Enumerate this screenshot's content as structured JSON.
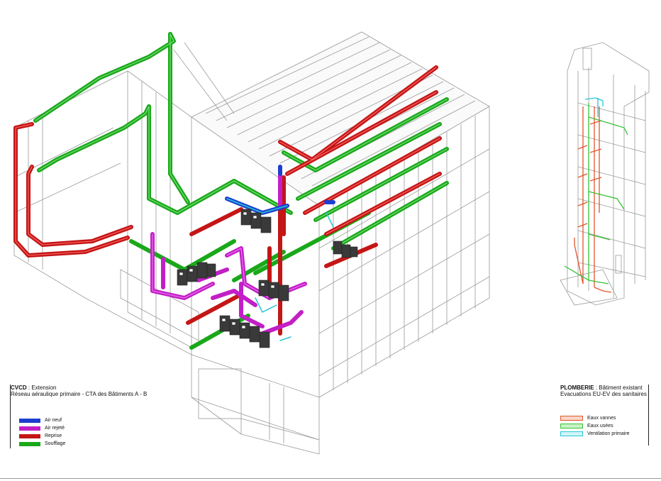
{
  "left_legend": {
    "title_bold": "CVCD",
    "title_rest": " : Extension",
    "subtitle": "Réseau aéraulique primaire - CTA des Bâtiments A - B",
    "items": [
      {
        "label": "Air neuf",
        "color": "#1d3fcf"
      },
      {
        "label": "Air rejeté",
        "color": "#c21fc7"
      },
      {
        "label": "Reprise",
        "color": "#c41616"
      },
      {
        "label": "Soufflage",
        "color": "#1aa81a"
      }
    ]
  },
  "right_legend": {
    "title_bold": "PLOMBERIE",
    "title_rest": " : Bâtiment existant",
    "subtitle": "Evacuations EU-EV des sanitaires",
    "items": [
      {
        "label": "Eaux vannes",
        "color": "#e0562e"
      },
      {
        "label": "Eaux usées",
        "color": "#36c236"
      },
      {
        "label": "Ventilation primaire",
        "color": "#27c6d4"
      }
    ]
  },
  "colors": {
    "air_neuf": "#1d3fcf",
    "air_rejete": "#c21fc7",
    "reprise": "#c41616",
    "soufflage": "#1aa81a",
    "linework": "#9a9a9a",
    "equipment": "#3a3a3a"
  }
}
